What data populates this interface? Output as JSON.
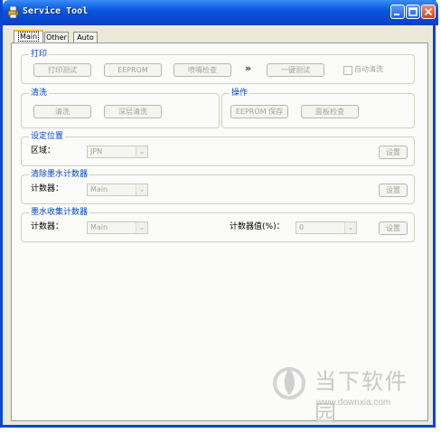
{
  "window": {
    "title": "Service Tool",
    "colors": {
      "titlebar": "#0a4ad2",
      "group_label": "#0046d5",
      "face": "#ece9d8"
    }
  },
  "tabs": [
    {
      "label": "Main",
      "active": true
    },
    {
      "label": "Other",
      "active": false
    },
    {
      "label": "Auto",
      "active": false
    }
  ],
  "print_group": {
    "label": "打印",
    "print_test": "打印测试",
    "eeprom": "EEPROM",
    "nozzle_check": "喷嘴检查",
    "arrows": "»",
    "one_key_test": "一键测试",
    "auto_clean_label": "自动清洗",
    "auto_clean_checked": false
  },
  "clean_group": {
    "label": "清洗",
    "clean": "清洗",
    "deep_clean": "深层清洗"
  },
  "operate_group": {
    "label": "操作",
    "eeprom_save": "EEPROM 保存",
    "panel_check": "面板检查"
  },
  "position_group": {
    "label": "设定位置",
    "region_label": "区域：",
    "region_value": "JPN",
    "set": "设置"
  },
  "ink_counter_group": {
    "label": "清除墨水计数器",
    "counter_label": "计数器：",
    "counter_value": "Main",
    "set": "设置"
  },
  "ink_collect_group": {
    "label": "墨水收集计数器",
    "counter_label": "计数器：",
    "counter_value": "Main",
    "counter_value_label": "计数器值(%)：",
    "counter_value_value": "0",
    "set": "设置"
  },
  "watermark": {
    "text": "当下软件园",
    "url": "www.downxia.com"
  }
}
